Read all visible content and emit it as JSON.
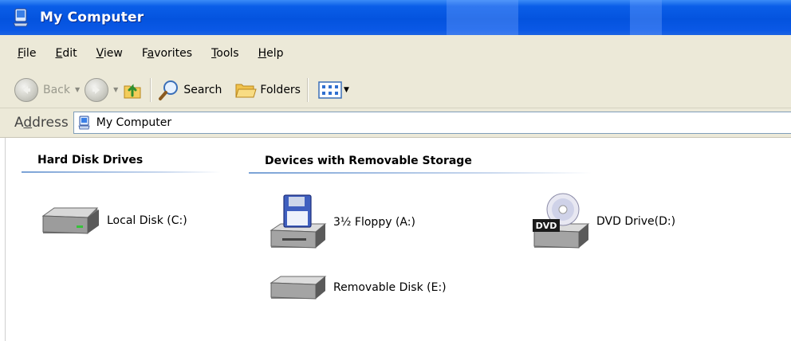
{
  "window": {
    "title": "My Computer",
    "title_color": "#0453de"
  },
  "menu": {
    "items": [
      {
        "label": "File",
        "hotkey": "F",
        "rest": "ile"
      },
      {
        "label": "Edit",
        "hotkey": "E",
        "rest": "dit"
      },
      {
        "label": "View",
        "hotkey": "V",
        "rest": "iew"
      },
      {
        "label": "Favorites",
        "pre": "F",
        "hotkey": "a",
        "rest": "vorites"
      },
      {
        "label": "Tools",
        "hotkey": "T",
        "rest": "ools"
      },
      {
        "label": "Help",
        "hotkey": "H",
        "rest": "elp"
      }
    ]
  },
  "toolbar": {
    "back_label": "Back",
    "search_label": "Search",
    "folders_label": "Folders"
  },
  "address": {
    "label_pre": "A",
    "label_hotkey": "d",
    "label_rest": "dress",
    "value": "My Computer"
  },
  "groups": {
    "hard_disk": {
      "header": "Hard Disk Drives",
      "items": [
        {
          "label": "Local Disk (C:)",
          "icon": "hard-disk-icon"
        }
      ]
    },
    "removable": {
      "header": "Devices with Removable Storage",
      "items": [
        {
          "label": "3½ Floppy (A:)",
          "icon": "floppy-drive-icon"
        },
        {
          "label": "DVD Drive(D:)",
          "icon": "dvd-drive-icon",
          "badge": "DVD"
        },
        {
          "label": "Removable Disk (E:)",
          "icon": "removable-disk-icon"
        }
      ]
    }
  }
}
